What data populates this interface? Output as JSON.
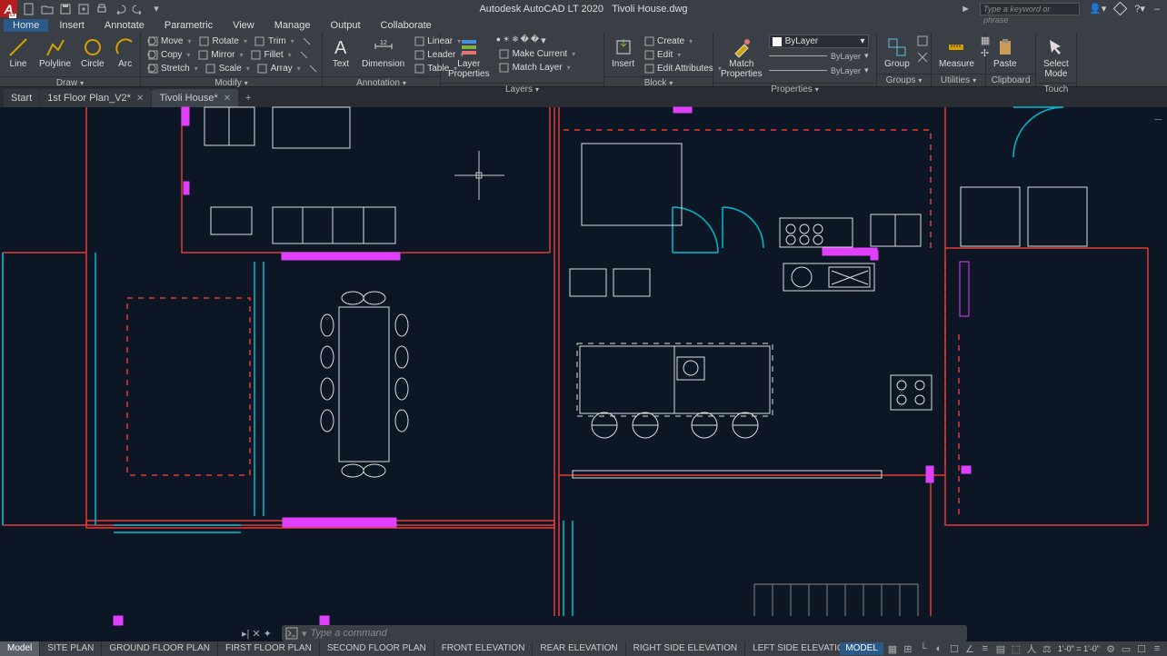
{
  "app": {
    "title": "Autodesk AutoCAD LT 2020",
    "document": "Tivoli House.dwg"
  },
  "search": {
    "placeholder": "Type a keyword or phrase"
  },
  "menus": [
    "Home",
    "Insert",
    "Annotate",
    "Parametric",
    "View",
    "Manage",
    "Output",
    "Collaborate"
  ],
  "active_menu": "Home",
  "ribbon": {
    "draw": {
      "title": "Draw",
      "big": [
        {
          "name": "line",
          "label": "Line"
        },
        {
          "name": "polyline",
          "label": "Polyline"
        },
        {
          "name": "circle",
          "label": "Circle"
        },
        {
          "name": "arc",
          "label": "Arc"
        }
      ]
    },
    "modify": {
      "title": "Modify",
      "rows": [
        [
          {
            "n": "move",
            "l": "Move"
          },
          {
            "n": "rotate",
            "l": "Rotate"
          },
          {
            "n": "trim",
            "l": "Trim"
          }
        ],
        [
          {
            "n": "copy",
            "l": "Copy"
          },
          {
            "n": "mirror",
            "l": "Mirror"
          },
          {
            "n": "fillet",
            "l": "Fillet"
          }
        ],
        [
          {
            "n": "stretch",
            "l": "Stretch"
          },
          {
            "n": "scale",
            "l": "Scale"
          },
          {
            "n": "array",
            "l": "Array"
          }
        ]
      ]
    },
    "annotation": {
      "title": "Annotation",
      "big": [
        {
          "name": "text",
          "label": "Text"
        },
        {
          "name": "dimension",
          "label": "Dimension"
        }
      ],
      "side": [
        {
          "n": "linear",
          "l": "Linear"
        },
        {
          "n": "leader",
          "l": "Leader"
        },
        {
          "n": "table",
          "l": "Table"
        }
      ]
    },
    "layers": {
      "title": "Layers",
      "big": {
        "name": "layer-props",
        "label": "Layer\nProperties"
      },
      "side": [
        {
          "n": "make-current",
          "l": "Make Current"
        },
        {
          "n": "match-layer",
          "l": "Match Layer"
        }
      ]
    },
    "block": {
      "title": "Block",
      "big": {
        "name": "insert",
        "label": "Insert"
      },
      "side": [
        {
          "n": "create",
          "l": "Create"
        },
        {
          "n": "edit",
          "l": "Edit"
        },
        {
          "n": "edit-attr",
          "l": "Edit Attributes"
        }
      ]
    },
    "properties": {
      "title": "Properties",
      "big": {
        "name": "match-props",
        "label": "Match\nProperties"
      },
      "bylayer": "ByLayer",
      "bylayer2": "ByLayer",
      "bylayer3": "ByLayer"
    },
    "groups": {
      "title": "Groups",
      "big": {
        "name": "group",
        "label": "Group"
      }
    },
    "utilities": {
      "title": "Utilities",
      "big": {
        "name": "measure",
        "label": "Measure"
      }
    },
    "clipboard": {
      "title": "Clipboard",
      "big": {
        "name": "paste",
        "label": "Paste"
      }
    },
    "touch": {
      "title": "Touch",
      "big": {
        "name": "select-mode",
        "label": "Select\nMode"
      }
    }
  },
  "filetabs": [
    {
      "name": "start",
      "label": "Start",
      "closable": false
    },
    {
      "name": "fp1",
      "label": "1st Floor Plan_V2*",
      "closable": true
    },
    {
      "name": "tivoli",
      "label": "Tivoli House*",
      "closable": true,
      "active": true
    }
  ],
  "layouttabs": [
    "Model",
    "SITE PLAN",
    "GROUND FLOOR PLAN",
    "FIRST FLOOR PLAN",
    "SECOND FLOOR PLAN",
    "FRONT  ELEVATION",
    "REAR  ELEVATION",
    "RIGHT SIDE ELEVATION",
    "LEFT SIDE  ELEVATION"
  ],
  "active_layout": "Model",
  "command": {
    "placeholder": "Type  a  command"
  },
  "status": {
    "model": "MODEL",
    "scale": "1'-0\" = 1'-0\""
  }
}
